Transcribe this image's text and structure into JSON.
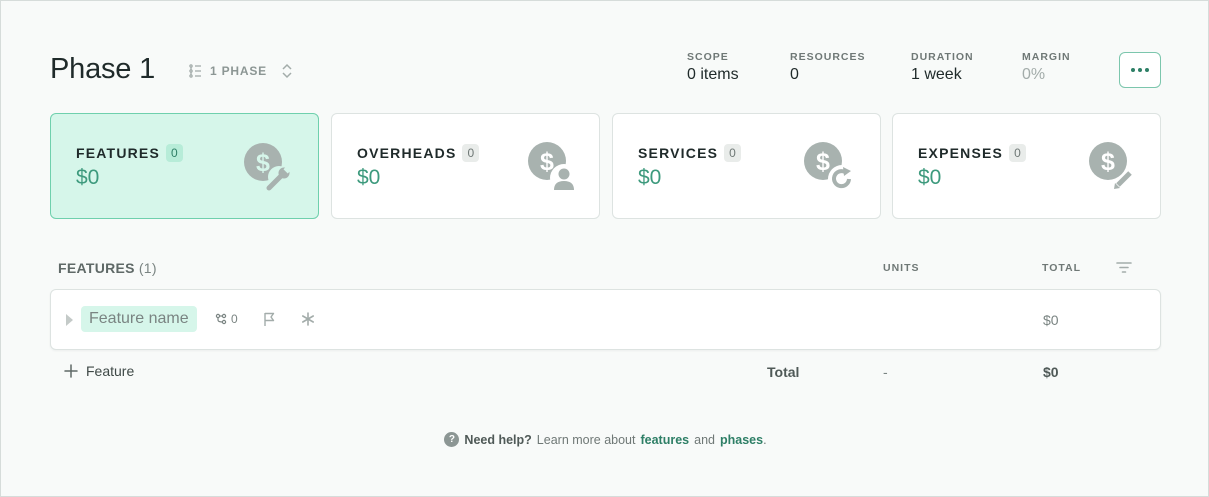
{
  "header": {
    "title": "Phase 1",
    "phase_selector": "1 PHASE",
    "stats": [
      {
        "key": "SCOPE",
        "value": "0 items"
      },
      {
        "key": "RESOURCES",
        "value": "0"
      },
      {
        "key": "DURATION",
        "value": "1 week"
      },
      {
        "key": "MARGIN",
        "value": "0%"
      }
    ],
    "more_button_icon": "more-horizontal-icon"
  },
  "cards": [
    {
      "label": "FEATURES",
      "count": "0",
      "amount": "$0",
      "icon": "dollar-wrench-icon",
      "active": true
    },
    {
      "label": "OVERHEADS",
      "count": "0",
      "amount": "$0",
      "icon": "dollar-person-icon",
      "active": false
    },
    {
      "label": "SERVICES",
      "count": "0",
      "amount": "$0",
      "icon": "dollar-refresh-icon",
      "active": false
    },
    {
      "label": "EXPENSES",
      "count": "0",
      "amount": "$0",
      "icon": "dollar-pencil-icon",
      "active": false
    }
  ],
  "table": {
    "title": "FEATURES",
    "count": "(1)",
    "col_units": "UNITS",
    "col_total": "TOTAL",
    "rows": [
      {
        "name": "Feature name",
        "dependencies": "0",
        "total": "$0"
      }
    ],
    "add_label": "Feature",
    "footer": {
      "label": "Total",
      "units": "-",
      "amount": "$0"
    }
  },
  "help": {
    "strong": "Need help?",
    "text": "Learn more about",
    "link1": "features",
    "and": "and",
    "link2": "phases",
    "end": "."
  },
  "colors": {
    "accent": "#3d9a7d",
    "active_card_bg": "#d6f6ea",
    "link": "#2e7f66"
  }
}
